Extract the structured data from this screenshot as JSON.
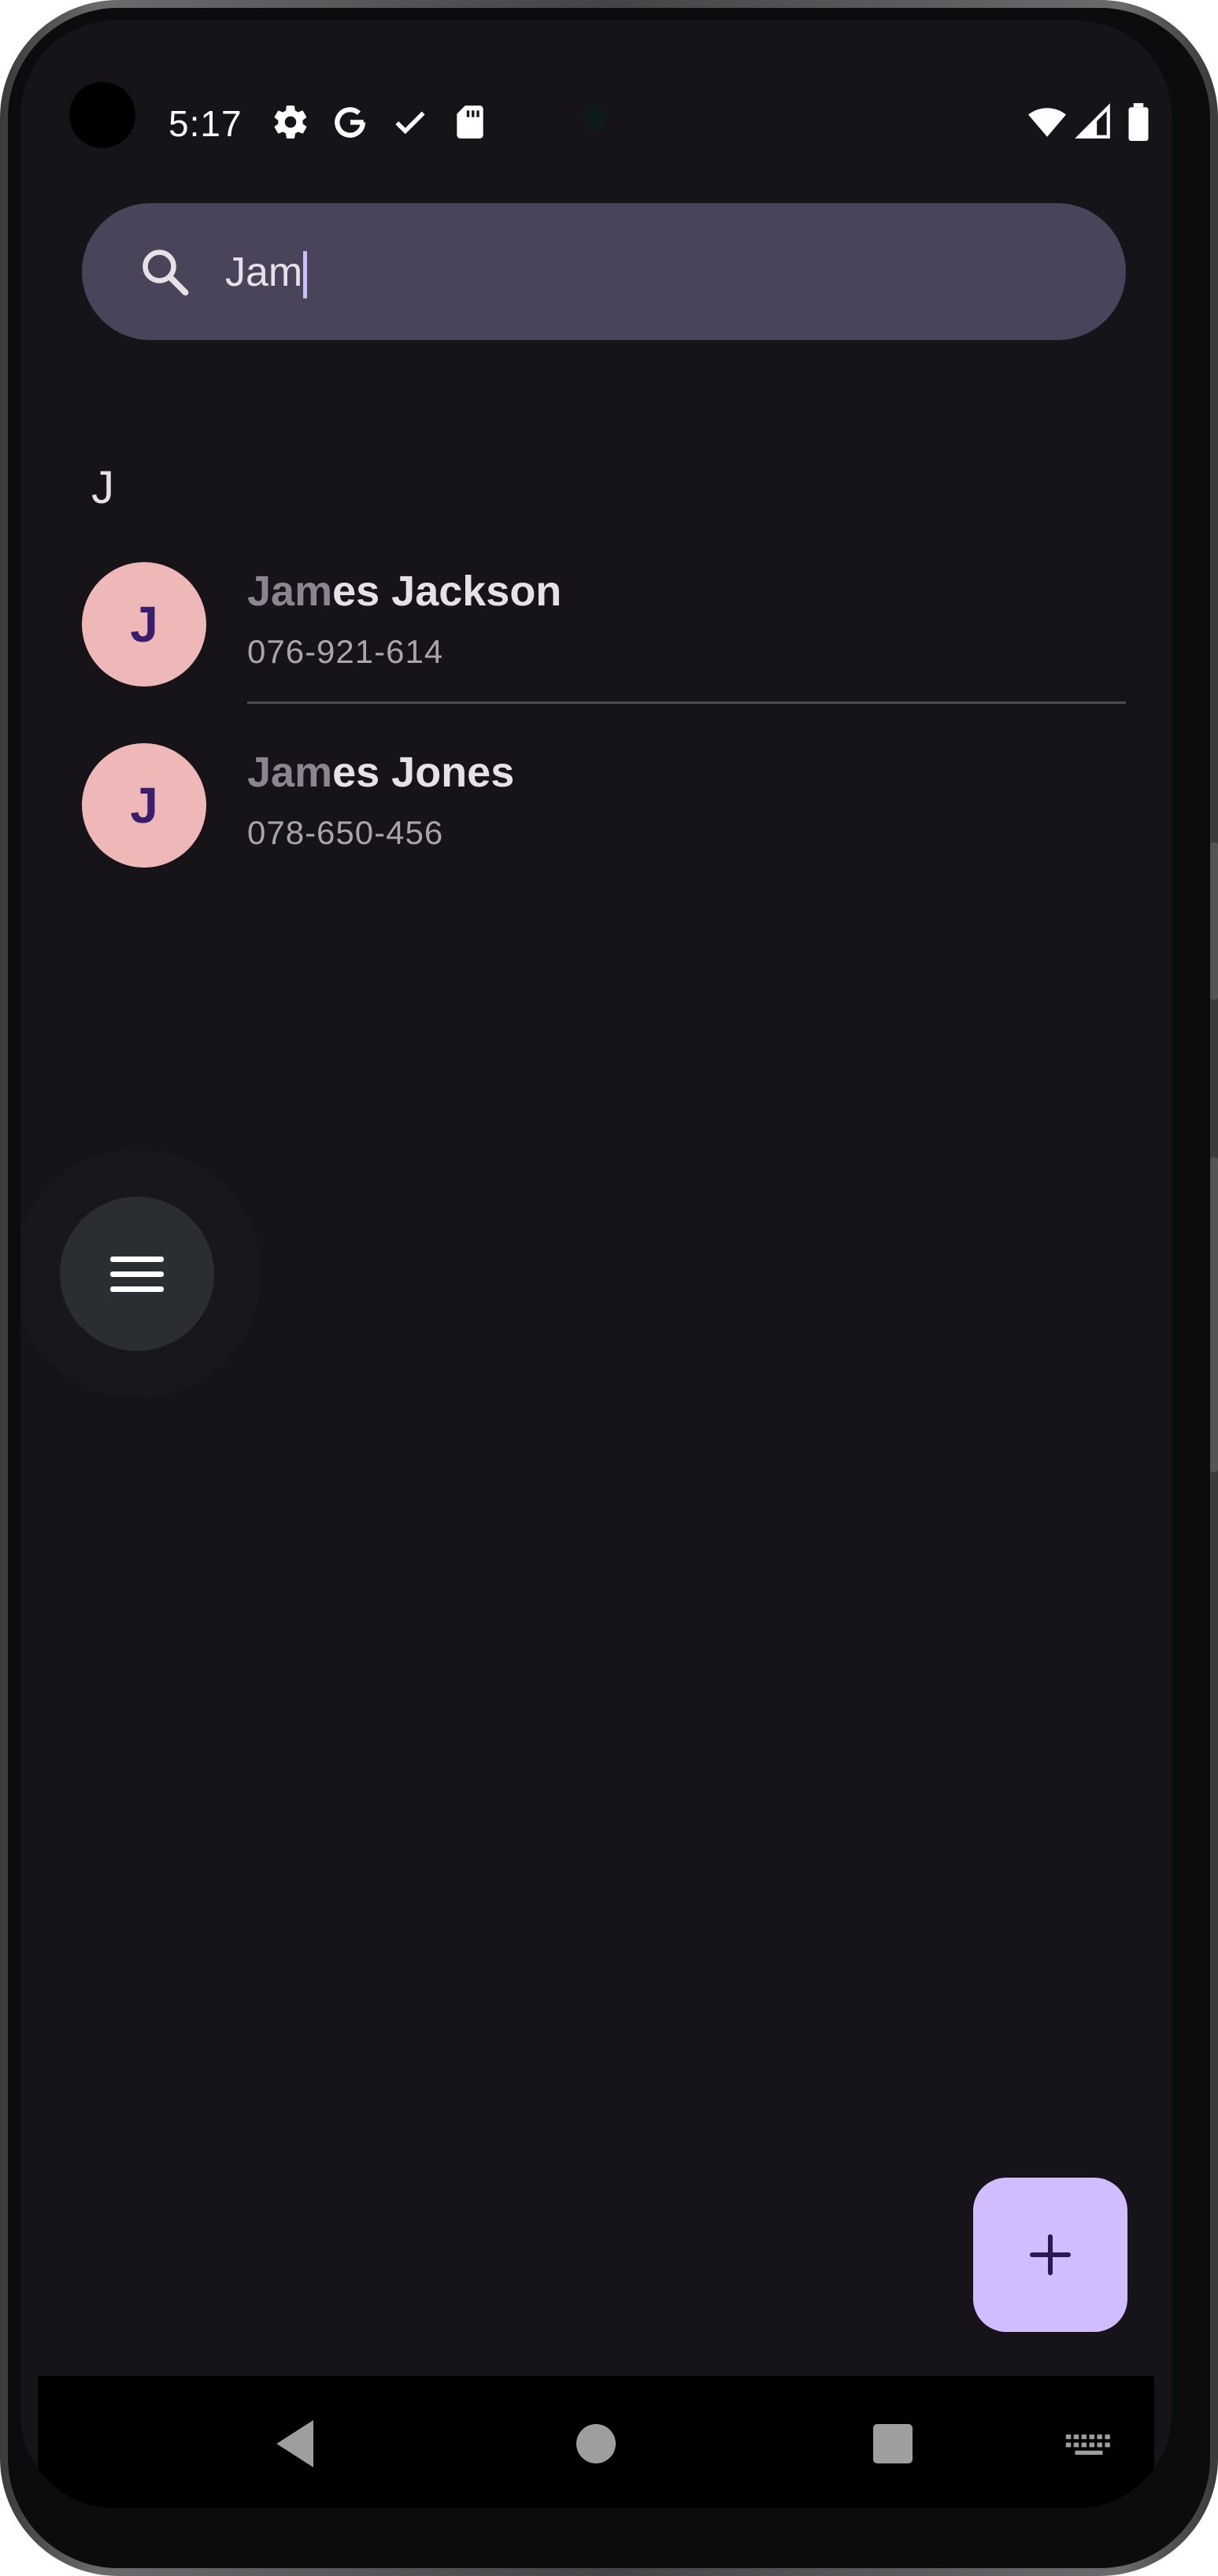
{
  "status_bar": {
    "time": "5:17",
    "left_icons": [
      "gear-icon",
      "google-icon",
      "check-icon",
      "sd-card-icon"
    ],
    "right_icons": [
      "wifi-icon",
      "cellular-signal-icon",
      "battery-icon"
    ]
  },
  "search": {
    "value": "Jam",
    "icon": "search-icon"
  },
  "contacts": {
    "section_header": "J",
    "items": [
      {
        "avatar_letter": "J",
        "name_match": "Jam",
        "name_rest": "es Jackson",
        "phone": "076-921-614"
      },
      {
        "avatar_letter": "J",
        "name_match": "Jam",
        "name_rest": "es Jones",
        "phone": "078-650-456"
      }
    ]
  },
  "floating_menu": {
    "icon": "hamburger-menu-icon"
  },
  "add_button": {
    "icon": "plus-icon"
  },
  "nav_bar": {
    "buttons": [
      "back-icon",
      "home-icon",
      "recents-icon",
      "keyboard-icon"
    ]
  },
  "colors": {
    "background": "#161419",
    "search_bg": "#49445a",
    "avatar_bg": "#efb8b8",
    "avatar_fg": "#3a1e6e",
    "fab_bg": "#d0bcff",
    "caret": "#cfbdfa"
  }
}
